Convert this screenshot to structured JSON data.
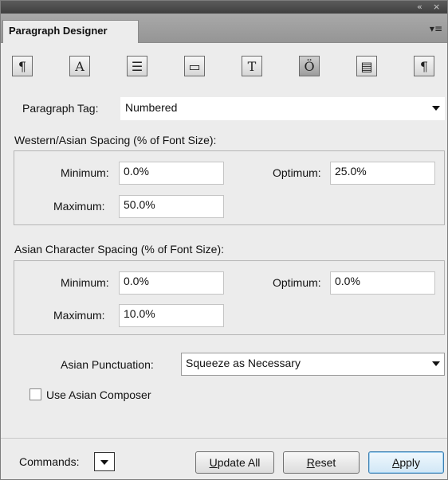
{
  "window": {
    "panel_title": "Paragraph Designer",
    "collapse_glyph": "«",
    "close_glyph": "×",
    "menu_glyph": "▾≡"
  },
  "toolbar": [
    {
      "name": "basic-properties-icon",
      "glyph": "¶"
    },
    {
      "name": "default-font-icon",
      "glyph": "A"
    },
    {
      "name": "pagination-icon",
      "glyph": "☰"
    },
    {
      "name": "numbering-icon",
      "glyph": "▭"
    },
    {
      "name": "advanced-icon",
      "glyph": "T"
    },
    {
      "name": "asia-icon",
      "glyph": "Ö"
    },
    {
      "name": "table-cell-icon",
      "glyph": "▤"
    },
    {
      "name": "direction-icon",
      "glyph": "¶"
    }
  ],
  "paragraph_tag": {
    "label": "Paragraph Tag:",
    "value": "Numbered"
  },
  "western_asian": {
    "title": "Western/Asian Spacing (% of Font Size):",
    "minimum_label": "Minimum:",
    "minimum_value": "0.0%",
    "optimum_label": "Optimum:",
    "optimum_value": "25.0%",
    "maximum_label": "Maximum:",
    "maximum_value": "50.0%"
  },
  "asian_character": {
    "title": "Asian Character Spacing (% of Font Size):",
    "minimum_label": "Minimum:",
    "minimum_value": "0.0%",
    "optimum_label": "Optimum:",
    "optimum_value": "0.0%",
    "maximum_label": "Maximum:",
    "maximum_value": "10.0%"
  },
  "asian_punctuation": {
    "label": "Asian Punctuation:",
    "value": "Squeeze as Necessary"
  },
  "use_asian_composer": {
    "label": "Use Asian Composer",
    "checked": false
  },
  "footer": {
    "commands_label": "Commands:",
    "update_all": {
      "first": "U",
      "rest": "pdate All"
    },
    "reset": {
      "first": "R",
      "rest": "eset"
    },
    "apply": {
      "first": "A",
      "rest": "pply"
    }
  }
}
